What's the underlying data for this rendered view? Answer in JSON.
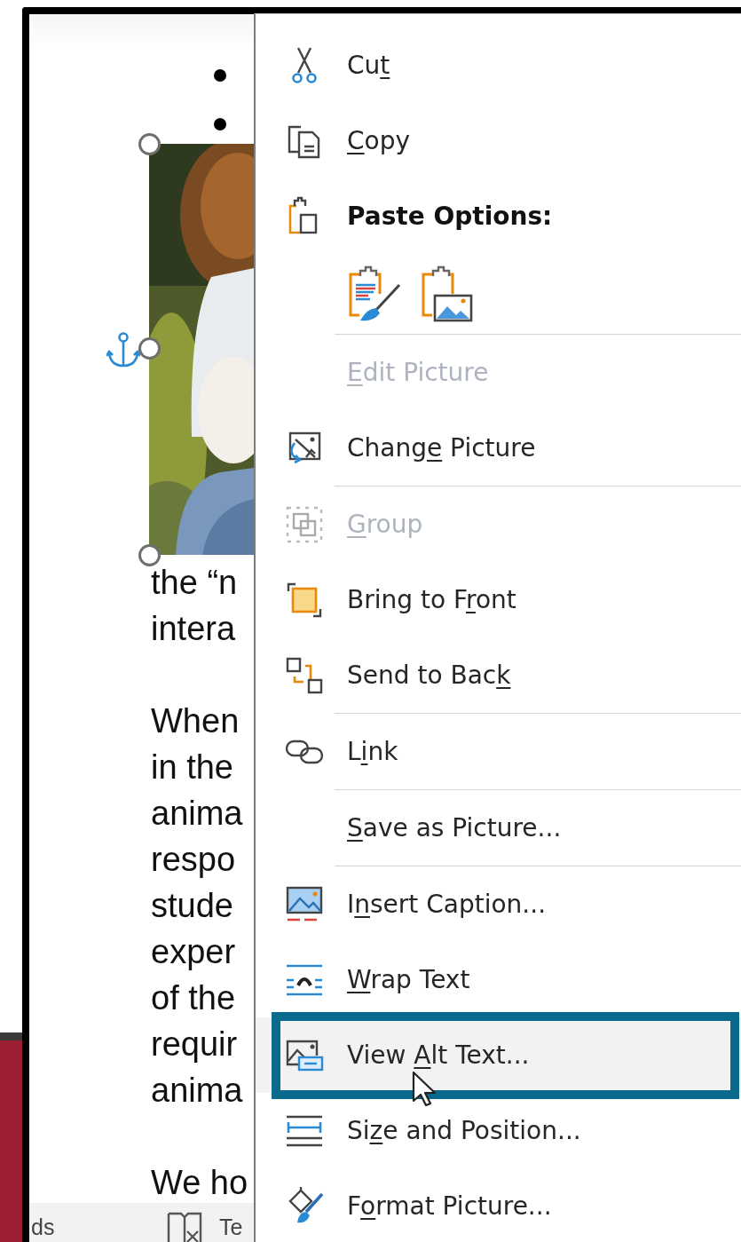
{
  "document": {
    "bullets": [
      {
        "kind": "bullet"
      },
      {
        "kind": "bullet"
      }
    ],
    "picture": {
      "kind": "picture",
      "selected": true,
      "anchored": true
    },
    "paragraphs": [
      [
        "the “n",
        "intera"
      ],
      [
        "When",
        "in the",
        "anima",
        "respo",
        "stude",
        "exper",
        "of the",
        "requir",
        "anima"
      ],
      [
        "We ho"
      ]
    ]
  },
  "status_bar": {
    "left_text": "ds",
    "right_text": "Te"
  },
  "context_menu": {
    "items": [
      {
        "kind": "command",
        "pre": "Cu",
        "key": "t",
        "disabled": false,
        "selected": false
      },
      {
        "kind": "command",
        "key": "C",
        "post": "opy",
        "disabled": false,
        "selected": false
      },
      {
        "kind": "heading",
        "label": "Paste Options:"
      },
      {
        "kind": "paste-buttons"
      },
      {
        "kind": "separator"
      },
      {
        "kind": "command",
        "key": "E",
        "post": "dit Picture",
        "disabled": true,
        "selected": false
      },
      {
        "kind": "command",
        "pre": "Chang",
        "key": "e",
        "post": " Picture",
        "disabled": false,
        "selected": false
      },
      {
        "kind": "separator"
      },
      {
        "kind": "command",
        "key": "G",
        "post": "roup",
        "disabled": true,
        "selected": false
      },
      {
        "kind": "command",
        "pre": "Bring to F",
        "key": "r",
        "post": "ont",
        "disabled": false,
        "selected": false
      },
      {
        "kind": "command",
        "pre": "Send to Bac",
        "key": "k",
        "disabled": false,
        "selected": false
      },
      {
        "kind": "separator"
      },
      {
        "kind": "command",
        "pre": "L",
        "key": "i",
        "post": "nk",
        "disabled": false,
        "selected": false
      },
      {
        "kind": "separator"
      },
      {
        "kind": "command",
        "key": "S",
        "post": "ave as Picture...",
        "disabled": false,
        "selected": false
      },
      {
        "kind": "separator"
      },
      {
        "kind": "command",
        "pre": "I",
        "key": "n",
        "post": "sert Caption...",
        "disabled": false,
        "selected": false
      },
      {
        "kind": "command",
        "key": "W",
        "post": "rap Text",
        "disabled": false,
        "selected": false
      },
      {
        "kind": "command",
        "pre": "View ",
        "key": "A",
        "post": "lt Text...",
        "disabled": false,
        "selected": true
      },
      {
        "kind": "command",
        "pre": "Si",
        "key": "z",
        "post": "e and Position...",
        "disabled": false,
        "selected": false
      },
      {
        "kind": "command",
        "pre": "F",
        "key": "o",
        "post": "rmat Picture...",
        "disabled": false,
        "selected": false
      }
    ]
  }
}
